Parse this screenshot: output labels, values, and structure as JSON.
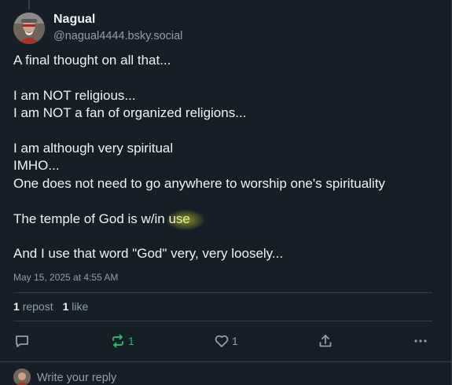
{
  "post": {
    "author": {
      "display_name": "Nagual",
      "handle": "@nagual4444.bsky.social"
    },
    "lines": [
      "A final thought on all that...",
      "",
      "I am NOT religious...",
      "I am NOT a fan of organized religions...",
      "",
      "I am although very spiritual",
      "IMHO...",
      "One does not need to go anywhere to worship one's spirituality",
      "",
      "The temple of God is w/in use",
      "",
      "And I use that word \"God\" very, very loosely..."
    ],
    "timestamp": "May 15, 2025 at 4:55 AM",
    "stats": {
      "repost_count": "1",
      "repost_label": "repost",
      "like_count": "1",
      "like_label": "like"
    },
    "actions": {
      "reply": {
        "icon": "reply-icon",
        "count": ""
      },
      "repost": {
        "icon": "repost-icon",
        "count": "1",
        "color": "#20bc6b"
      },
      "like": {
        "icon": "heart-icon",
        "count": "1"
      },
      "share": {
        "icon": "share-icon"
      },
      "more": {
        "icon": "more-icon"
      }
    }
  },
  "reply_composer": {
    "placeholder": "Write your reply"
  },
  "colors": {
    "background": "#161e27",
    "text": "#f1f3f5",
    "muted": "#8d9fb2",
    "border": "#2e4052",
    "repost_active": "#20bc6b",
    "highlight": "#dce628"
  }
}
